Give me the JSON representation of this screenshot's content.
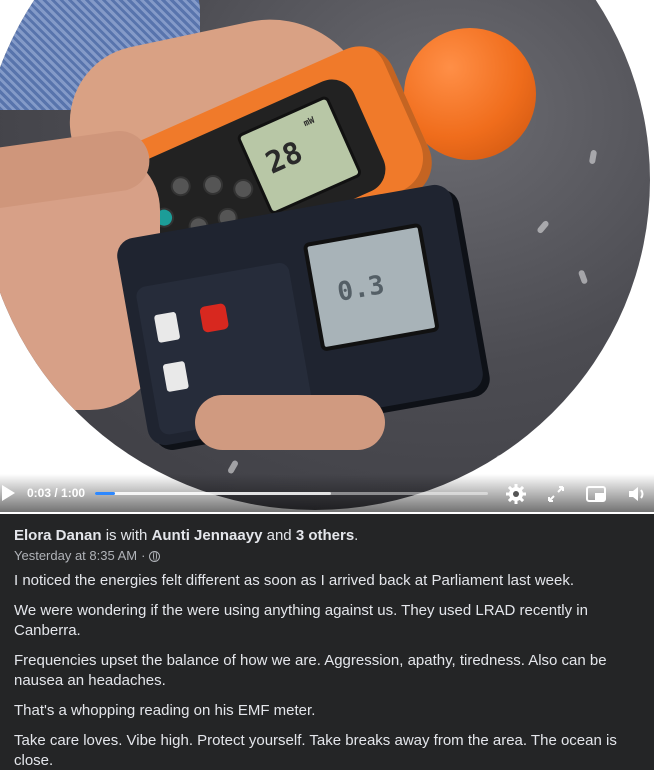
{
  "video": {
    "time_display": "0:03 / 1:00",
    "progress": 0.05,
    "buffered": 0.6,
    "icons": [
      "play-icon",
      "gear-icon",
      "expand-icon",
      "picture-in-picture-icon",
      "volume-icon"
    ],
    "accent_color": "#2d88ff"
  },
  "post": {
    "author": "Elora Danan",
    "with_text": "is with",
    "tagged_person": "Aunti Jennaayy",
    "and_text": "and",
    "others": "3 others",
    "end_punct": ".",
    "timestamp": "Yesterday at 8:35 AM",
    "separator": "·",
    "audience_icon": "globe-icon",
    "paragraphs": [
      "I noticed the energies felt different as soon as I arrived back at Parliament last week.",
      "We were wondering if the were using anything against us. They used LRAD recently in Canberra.",
      "Frequencies upset the balance of how we are. Aggression, apathy, tiredness. Also can be nausea an headaches.",
      "That's a whopping reading on his EMF meter.",
      "Take care loves. Vibe high. Protect yourself. Take breaks away from the area. The ocean is close."
    ]
  }
}
